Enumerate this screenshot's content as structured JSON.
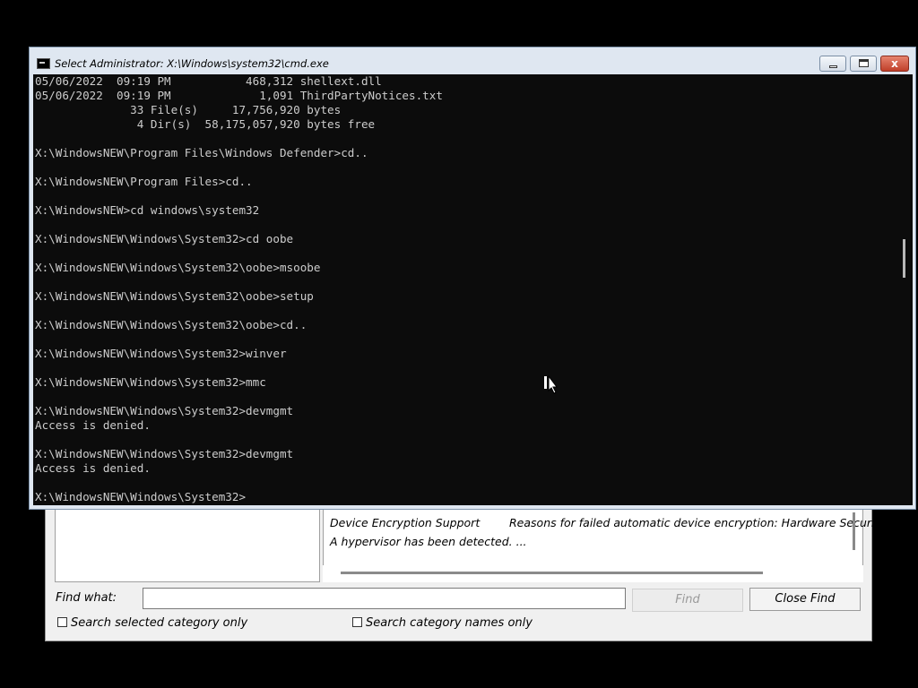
{
  "cmd": {
    "title": "Select Administrator: X:\\Windows\\system32\\cmd.exe",
    "buttons": {
      "minimize": "",
      "maximize": "",
      "close": "x"
    },
    "lines": [
      "05/06/2022  09:19 PM           468,312 shellext.dll",
      "05/06/2022  09:19 PM             1,091 ThirdPartyNotices.txt",
      "              33 File(s)     17,756,920 bytes",
      "               4 Dir(s)  58,175,057,920 bytes free",
      "",
      "X:\\WindowsNEW\\Program Files\\Windows Defender>cd..",
      "",
      "X:\\WindowsNEW\\Program Files>cd..",
      "",
      "X:\\WindowsNEW>cd windows\\system32",
      "",
      "X:\\WindowsNEW\\Windows\\System32>cd oobe",
      "",
      "X:\\WindowsNEW\\Windows\\System32\\oobe>msoobe",
      "",
      "X:\\WindowsNEW\\Windows\\System32\\oobe>setup",
      "",
      "X:\\WindowsNEW\\Windows\\System32\\oobe>cd..",
      "",
      "X:\\WindowsNEW\\Windows\\System32>winver",
      "",
      "X:\\WindowsNEW\\Windows\\System32>mmc",
      "",
      "X:\\WindowsNEW\\Windows\\System32>devmgmt",
      "Access is denied.",
      "",
      "X:\\WindowsNEW\\Windows\\System32>devmgmt",
      "Access is denied.",
      "",
      "X:\\WindowsNEW\\Windows\\System32>"
    ]
  },
  "msinfo": {
    "row": {
      "item": "Device Encryption Support",
      "value": "Reasons for failed automatic device encryption: Hardware Security T",
      "value_line2": "A hypervisor has been detected. ..."
    },
    "find": {
      "label": "Find what:",
      "input_value": "",
      "find_button": "Find",
      "close_button": "Close Find",
      "checkbox1_label": "Search selected category only",
      "checkbox2_label": "Search category names only"
    }
  }
}
